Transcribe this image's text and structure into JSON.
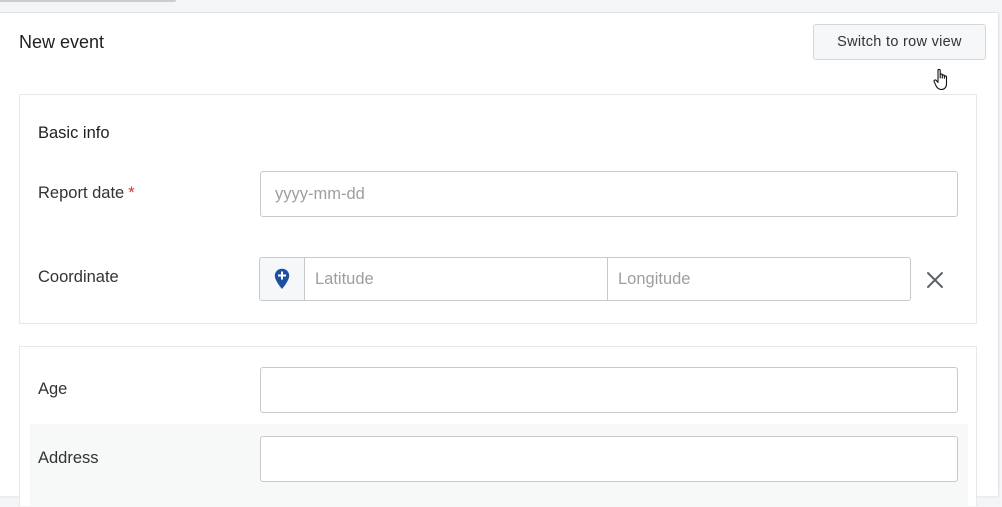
{
  "header": {
    "title": "New event",
    "switch_button_label": "Switch to row view"
  },
  "basic_info": {
    "title": "Basic info",
    "report_date": {
      "label": "Report date",
      "required_mark": "*",
      "placeholder": "yyyy-mm-dd"
    },
    "coordinate": {
      "label": "Coordinate",
      "latitude_placeholder": "Latitude",
      "longitude_placeholder": "Longitude"
    }
  },
  "details": {
    "age": {
      "label": "Age",
      "value": ""
    },
    "address": {
      "label": "Address",
      "value": ""
    }
  },
  "icons": {
    "location": "location-pin-icon",
    "clear": "close-icon",
    "cursor": "hand-cursor-icon"
  },
  "colors": {
    "accent": "#1f4fa3",
    "required": "#e0322a"
  }
}
